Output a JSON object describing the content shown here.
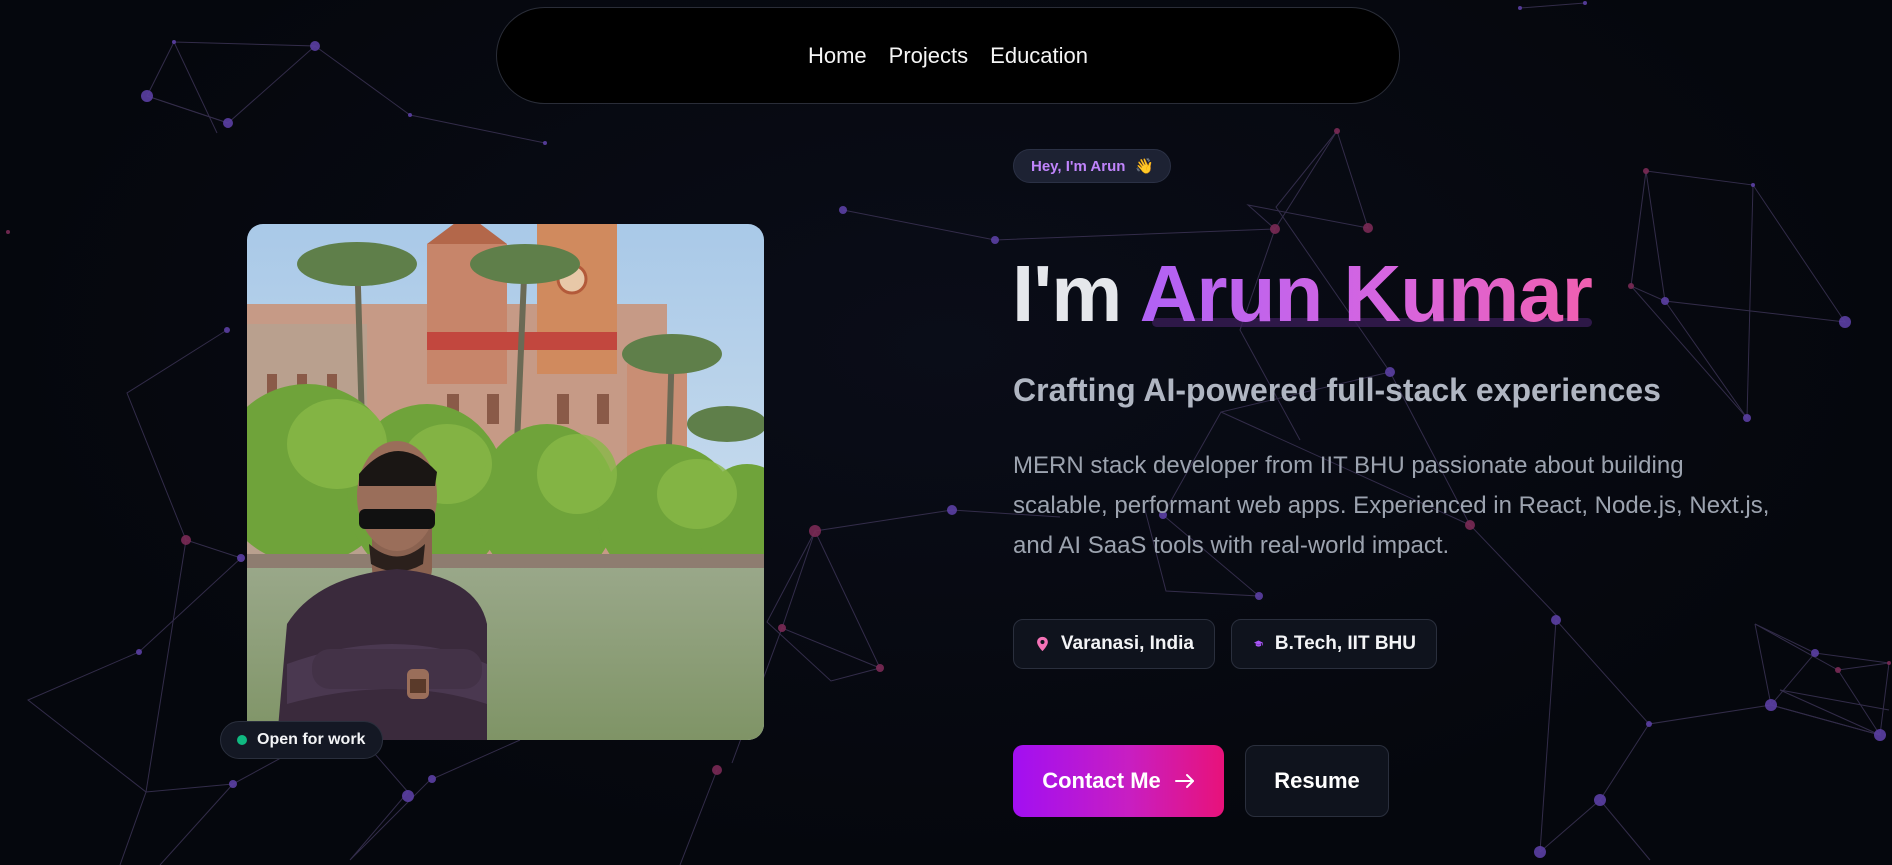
{
  "nav": {
    "items": [
      {
        "label": "Home"
      },
      {
        "label": "Projects"
      },
      {
        "label": "Education"
      }
    ]
  },
  "hero": {
    "greeting": "Hey, I'm Arun",
    "greeting_icon": "waving-hand-icon",
    "headline_lead": "I'm",
    "headline_name": "Arun Kumar",
    "subheadline": "Crafting AI-powered full-stack experiences",
    "description": "MERN stack developer from IIT BHU passionate about building scalable, performant web apps. Experienced in React, Node.js, Next.js, and AI SaaS tools with real-world impact.",
    "location": "Varanasi, India",
    "location_icon": "map-pin-icon",
    "degree": "B.Tech, IIT BHU",
    "degree_icon": "graduation-cap-icon",
    "contact_label": "Contact Me",
    "contact_icon": "arrow-right-icon",
    "resume_label": "Resume"
  },
  "profile": {
    "photo": "profile-photo",
    "status": "Open for work"
  },
  "colors": {
    "background": "#05070d",
    "accent_purple": "#a855f7",
    "accent_pink": "#ec4899",
    "status_green": "#10b981"
  }
}
